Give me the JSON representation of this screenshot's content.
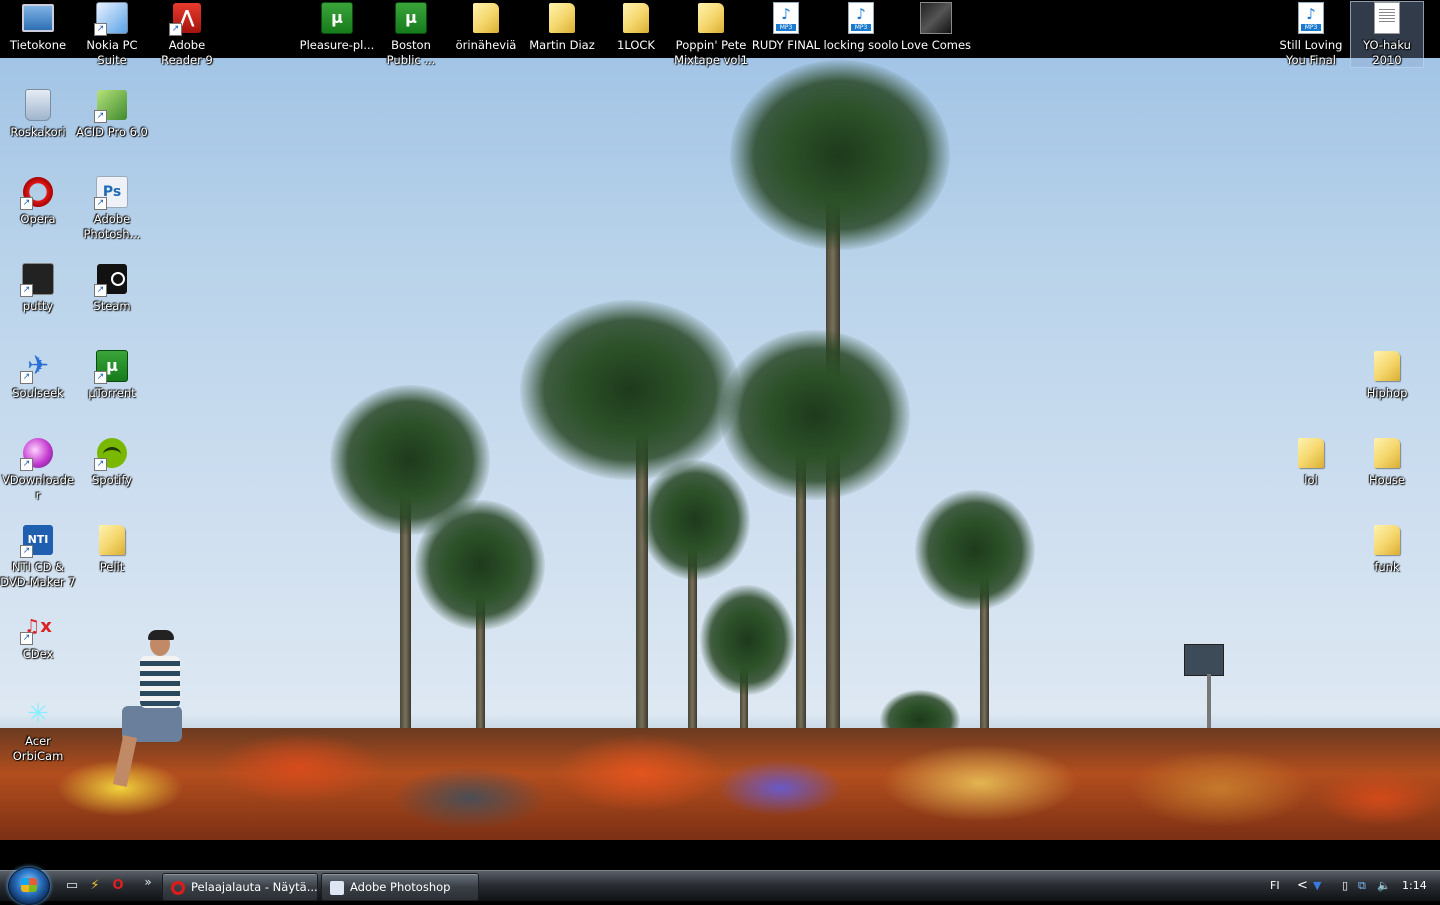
{
  "desktop_icons": {
    "tietokone": "Tietokone",
    "nokia": "Nokia PC Suite",
    "adobe_reader": "Adobe Reader 9",
    "pleasure": "Pleasure-pl...",
    "boston": "Boston Public ...",
    "orinahevia": "örinäheviä",
    "martin": "Martin Diaz",
    "onelock": "1LOCK",
    "poppin": "Poppin' Pete Mixtape vol1",
    "rudy": "RUDY FINAL",
    "locking": "locking soolo",
    "love": "Love Comes",
    "still_loving": "Still Loving You Final",
    "yo_haku": "YO-haku 2010",
    "roskakori": "Roskakori",
    "acid": "ACID Pro 6.0",
    "opera": "Opera",
    "photoshop": "Adobe Photosh...",
    "putty": "putty",
    "steam": "Steam",
    "soulseek": "Soulseek",
    "utorrent": "µTorrent",
    "vdownloader": "VDownloader",
    "spotify": "Spotify",
    "nti": "NTI CD & DVD-Maker 7",
    "pelit": "Pelit",
    "cdex": "CDex",
    "acer": "Acer OrbiCam",
    "hiphop": "Hiphop",
    "lol": "lol",
    "house": "House",
    "funk": "funk"
  },
  "taskbar": {
    "overflow": "»",
    "opera_window": "Pelaajalauta - Näytä...",
    "photoshop_window": "Adobe Photoshop",
    "language": "FI",
    "tray_expand": "<",
    "clock": "1:14"
  },
  "colors": {
    "taskbar": "#2a2e34",
    "folder": "#f4d56a",
    "utorrent": "#167c1c",
    "sky": "#b9d3ea"
  }
}
